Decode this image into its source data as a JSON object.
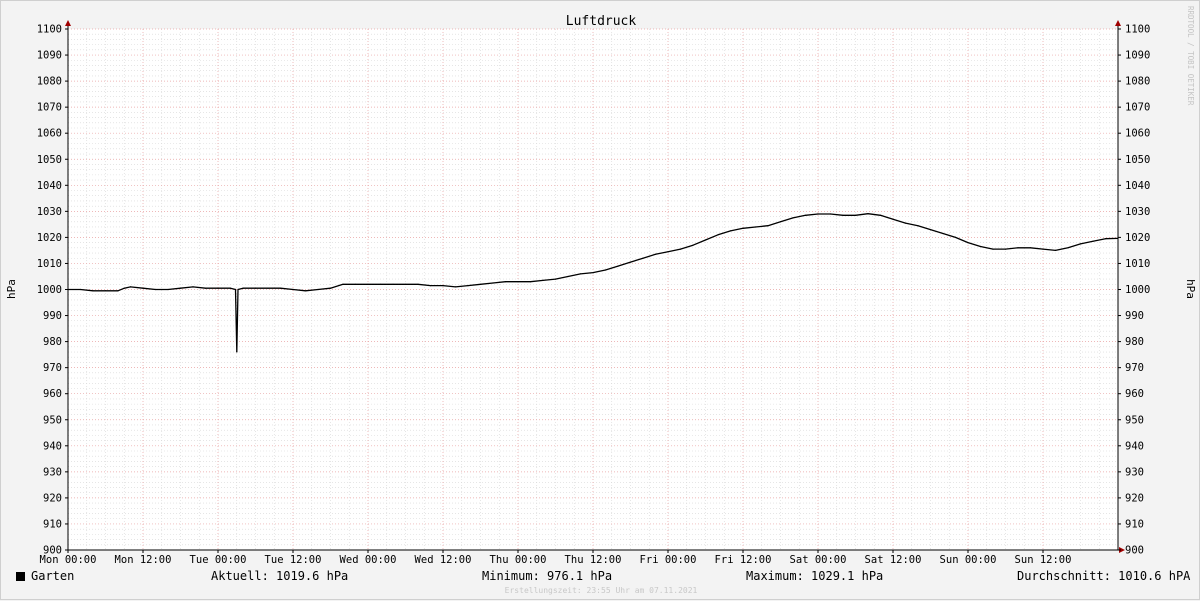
{
  "chart_data": {
    "type": "line",
    "title": "Luftdruck",
    "ylabel": "hPa",
    "ylim": [
      900,
      1100
    ],
    "y_ticks": [
      1100,
      1090,
      1080,
      1070,
      1060,
      1050,
      1040,
      1030,
      1020,
      1010,
      1000,
      990,
      980,
      970,
      960,
      950,
      940,
      930,
      920,
      910,
      900
    ],
    "x_ticks": [
      "Mon 00:00",
      "Mon 12:00",
      "Tue 00:00",
      "Tue 12:00",
      "Wed 00:00",
      "Wed 12:00",
      "Thu 00:00",
      "Thu 12:00",
      "Fri 00:00",
      "Fri 12:00",
      "Sat 00:00",
      "Sat 12:00",
      "Sun 00:00",
      "Sun 12:00"
    ],
    "x_unit": "hours since Mon 00:00",
    "x_range": [
      0,
      168
    ],
    "grid": true,
    "series": [
      {
        "name": "Garten",
        "color": "#000000",
        "x": [
          0,
          2,
          4,
          6,
          8,
          9,
          10,
          12,
          14,
          16,
          18,
          20,
          22,
          24,
          26,
          26.8,
          27,
          27.2,
          28,
          30,
          32,
          34,
          36,
          38,
          40,
          42,
          44,
          46,
          48,
          50,
          52,
          54,
          56,
          58,
          60,
          62,
          64,
          66,
          68,
          70,
          72,
          74,
          76,
          78,
          80,
          82,
          84,
          86,
          88,
          90,
          92,
          94,
          96,
          98,
          100,
          102,
          104,
          106,
          108,
          110,
          112,
          114,
          116,
          118,
          120,
          122,
          124,
          126,
          128,
          130,
          132,
          134,
          136,
          138,
          140,
          142,
          144,
          146,
          148,
          150,
          152,
          154,
          156,
          158,
          160,
          162,
          164,
          166,
          168
        ],
        "values": [
          1000,
          1000,
          999.5,
          999.5,
          999.5,
          1000.5,
          1001,
          1000.5,
          1000,
          1000,
          1000.5,
          1001,
          1000.5,
          1000.5,
          1000.5,
          1000,
          976.1,
          1000,
          1000.5,
          1000.5,
          1000.5,
          1000.5,
          1000,
          999.5,
          1000,
          1000.5,
          1002,
          1002,
          1002,
          1002,
          1002,
          1002,
          1002,
          1001.5,
          1001.5,
          1001,
          1001.5,
          1002,
          1002.5,
          1003,
          1003,
          1003,
          1003.5,
          1004,
          1005,
          1006,
          1006.5,
          1007.5,
          1009,
          1010.5,
          1012,
          1013.5,
          1014.5,
          1015.5,
          1017,
          1019,
          1021,
          1022.5,
          1023.5,
          1024,
          1024.5,
          1026,
          1027.5,
          1028.5,
          1029,
          1029,
          1028.5,
          1028.5,
          1029.1,
          1028.5,
          1027,
          1025.5,
          1024.5,
          1023,
          1021.5,
          1020,
          1018,
          1016.5,
          1015.5,
          1015.5,
          1016,
          1016,
          1015.5,
          1015,
          1016,
          1017.5,
          1018.5,
          1019.5,
          1019.6
        ]
      }
    ]
  },
  "legend": {
    "series_name": "Garten",
    "current": "Aktuell: 1019.6 hPa",
    "minimum": "Minimum: 976.1 hPa",
    "maximum": "Maximum: 1029.1 hPa",
    "average": "Durchschnitt: 1010.6 hPA"
  },
  "footer": "Erstellungszeit: 23:55 Uhr am 07.11.2021",
  "watermark": "RRDTOOL / TOBI OETIKER"
}
